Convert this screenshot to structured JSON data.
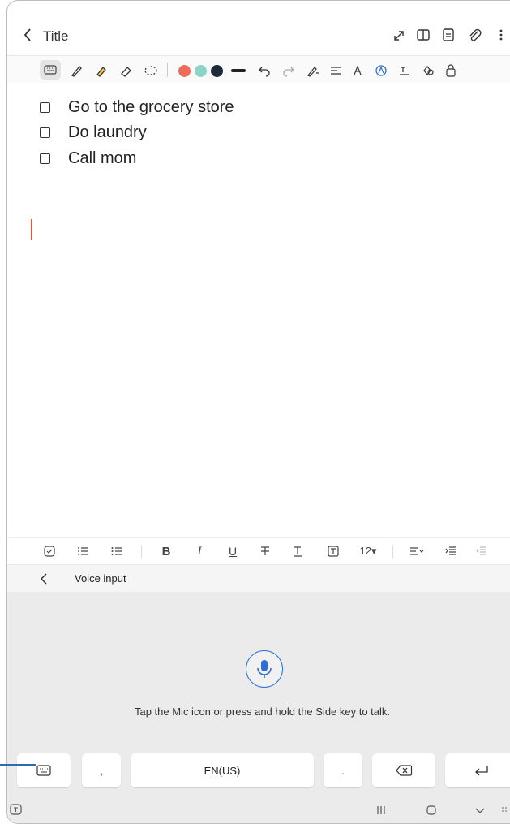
{
  "topbar": {
    "title": "Title",
    "icons": [
      "back-icon",
      "expand-icon",
      "book-icon",
      "page-icon",
      "attach-icon",
      "more-icon"
    ]
  },
  "pen_toolbar": {
    "icons": [
      "keyboard-mode-icon",
      "pen-icon",
      "highlighter-icon",
      "eraser-icon",
      "lasso-icon",
      "line-style-icon",
      "undo-icon",
      "redo-icon",
      "pen-settings-icon",
      "text-align-icon",
      "text-size-icon",
      "text-effect-icon",
      "text-box-icon",
      "shapes-icon",
      "lock-icon"
    ],
    "colors": [
      "#ee6b5b",
      "#8cd3c8",
      "#1e2a3a"
    ]
  },
  "checklist": [
    {
      "text": "Go to the grocery store",
      "checked": false
    },
    {
      "text": "Do laundry",
      "checked": false
    },
    {
      "text": "Call mom",
      "checked": false
    }
  ],
  "format_toolbar": {
    "bold": "B",
    "italic": "I",
    "underline": "U",
    "font_size": "12▾"
  },
  "voice_input": {
    "label": "Voice input",
    "hint": "Tap the Mic icon or press and hold the Side key to talk."
  },
  "keyboard": {
    "comma": ",",
    "language": "EN(US)",
    "period": "."
  },
  "colors": {
    "accent": "#2d6fd6",
    "cursor": "#e8562e"
  }
}
